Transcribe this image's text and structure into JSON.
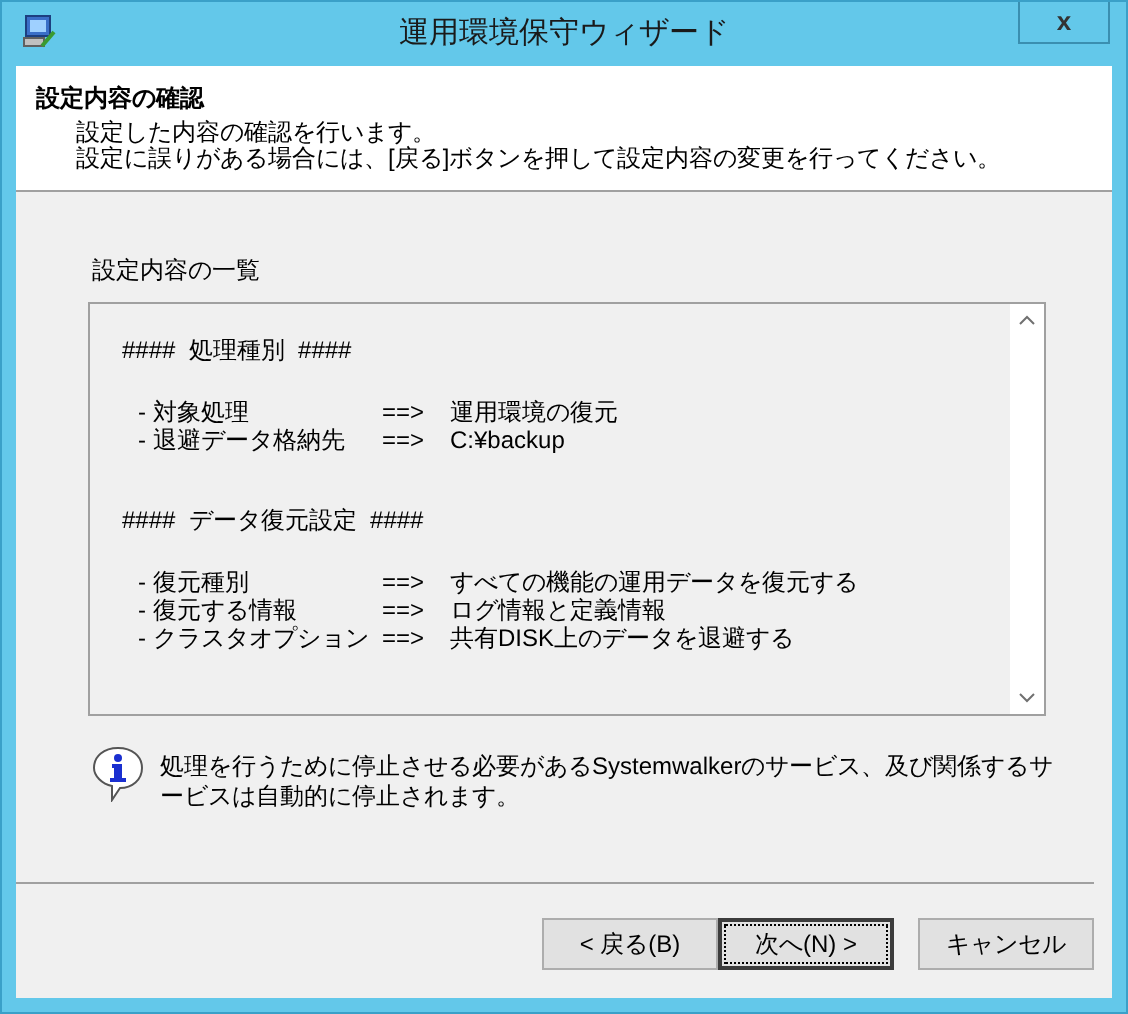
{
  "window": {
    "title": "運用環境保守ウィザード",
    "close": "x"
  },
  "header": {
    "title": "設定内容の確認",
    "description": [
      "設定した内容の確認を行います。",
      "設定に誤りがある場合には、[戻る]ボタンを押して設定内容の変更を行ってください。"
    ]
  },
  "summary": {
    "label": "設定内容の一覧",
    "lines": [
      {
        "kind": "heading",
        "text": "####  処理種別  ####"
      },
      {
        "kind": "item",
        "label": "- 対象処理",
        "arrow": "==>",
        "value": "運用環境の復元"
      },
      {
        "kind": "item",
        "label": "- 退避データ格納先",
        "arrow": "==>",
        "value": "C:¥backup"
      },
      {
        "kind": "heading",
        "text": "####  データ復元設定  ####"
      },
      {
        "kind": "item",
        "label": "- 復元種別",
        "arrow": "==>",
        "value": "すべての機能の運用データを復元する"
      },
      {
        "kind": "item",
        "label": "- 復元する情報",
        "arrow": "==>",
        "value": "ログ情報と定義情報"
      },
      {
        "kind": "item",
        "label": "- クラスタオプション",
        "arrow": "==>",
        "value": "共有DISK上のデータを退避する"
      }
    ]
  },
  "info": {
    "text": "処理を行うために停止させる必要があるSystemwalkerのサービス、及び関係するサービスは自動的に停止されます。"
  },
  "buttons": [
    {
      "label": "< 戻る(B)",
      "default": false
    },
    {
      "label": "次へ(N) >",
      "default": true
    },
    {
      "label": "キャンセル",
      "default": false
    }
  ]
}
